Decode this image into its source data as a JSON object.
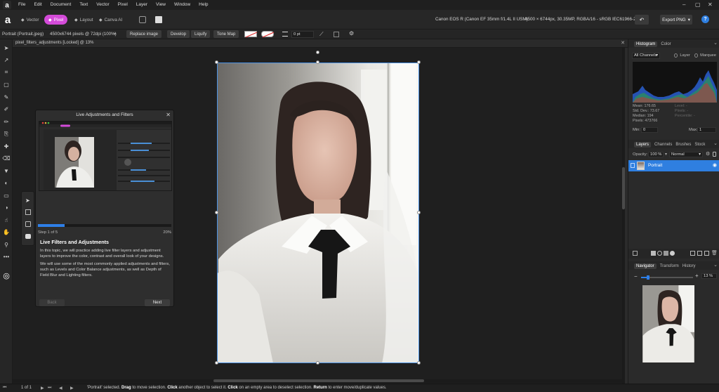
{
  "menu": {
    "items": [
      "File",
      "Edit",
      "Document",
      "Text",
      "Vector",
      "Pixel",
      "Layer",
      "View",
      "Window",
      "Help"
    ]
  },
  "personas": [
    {
      "label": "Vector",
      "active": false
    },
    {
      "label": "Pixel",
      "active": true
    },
    {
      "label": "Layout",
      "active": false
    },
    {
      "label": "Canva AI",
      "active": false
    }
  ],
  "toolbar": {
    "camera_info": "Canon EOS R (Canon EF 35mm f/1.4L II USM)",
    "doc_size_info": "4500 × 6744px, 30.35MP, RGBA/16 - sRGB IEC61966-2.1",
    "export_label": "Export PNG",
    "help_label": "?"
  },
  "context_bar": {
    "layer_name": "Portrait (Portrait.jpeg)",
    "pixel_info": "4500x6744 pixels @ 72dpi (100%)",
    "replace_image": "Replace image",
    "develop": "Develop",
    "liquify": "Liquify",
    "tone_map": "Tone Map",
    "stroke_width": "0 pt"
  },
  "document_tab": {
    "title": "pixel_filters_adjustments [Locked] @ 13%"
  },
  "tutorial": {
    "title": "Live Adjustments and Filters",
    "step_label": "Step 1 of 5",
    "percent_label": "20%",
    "progress": 0.2,
    "heading": "Live Filters and Adjustments",
    "paragraph1": "In this topic, we will practice adding live filter layers and adjustment layers to improve the color, contrast and overall look of your designs.",
    "paragraph2": "We will use some of the most commonly applied adjustments and filters, such as Levels and Color Balance adjustments, as well as Depth of Field Blur and Lighting filters.",
    "back_label": "Back",
    "next_label": "Next"
  },
  "histogram_panel": {
    "tabs": [
      {
        "label": "Histogram",
        "active": true
      },
      {
        "label": "Color",
        "active": false
      }
    ],
    "channel_select": "All Channels",
    "layer_label": "Layer",
    "marquee_label": "Marquee",
    "stats_left": [
      "Mean: 176.65",
      "Std. Dev.: 73.67",
      "Median: 194",
      "Pixels: 473766"
    ],
    "stats_right": [
      "Level: -",
      "Pixels: -",
      "Percentile: -"
    ],
    "min_label": "Min:",
    "min_value": "0",
    "max_label": "Max:",
    "max_value": "1"
  },
  "layers_panel": {
    "tabs": [
      {
        "label": "Layers",
        "active": true
      },
      {
        "label": "Channels",
        "active": false
      },
      {
        "label": "Brushes",
        "active": false
      },
      {
        "label": "Stock",
        "active": false
      }
    ],
    "opacity_label": "Opacity:",
    "opacity_value": "100 %",
    "blend_mode": "Normal",
    "layers": [
      {
        "name": "Portrait",
        "selected": true
      }
    ]
  },
  "navigator_panel": {
    "tabs": [
      {
        "label": "Navigator",
        "active": true
      },
      {
        "label": "Transform",
        "active": false
      },
      {
        "label": "History",
        "active": false
      }
    ],
    "zoom_value": "13 %",
    "zoom_fraction": 0.13
  },
  "statusbar": {
    "page_info": "1 of 1",
    "msg_parts": [
      {
        "t": "'Portrait' selected. ",
        "b": false
      },
      {
        "t": "Drag",
        "b": true
      },
      {
        "t": " to move selection. ",
        "b": false
      },
      {
        "t": "Click",
        "b": true
      },
      {
        "t": " another object to select it. ",
        "b": false
      },
      {
        "t": "Click",
        "b": true
      },
      {
        "t": " on an empty area to deselect selection. ",
        "b": false
      },
      {
        "t": "Return",
        "b": true
      },
      {
        "t": " to enter move/duplicate values.",
        "b": false
      }
    ]
  },
  "colors": {
    "accent": "#2e7fe8",
    "persona_active": "#d44bd9",
    "selection": "#4a90e2"
  }
}
